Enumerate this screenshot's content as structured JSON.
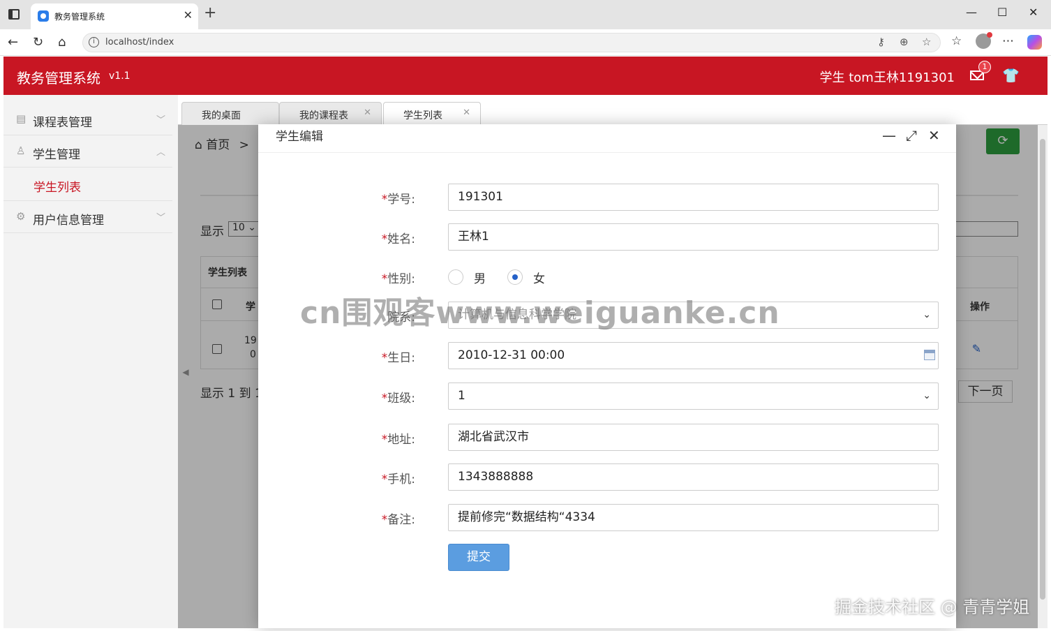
{
  "browser": {
    "tab_title": "教务管理系统",
    "url": "localhost/index"
  },
  "app": {
    "title": "教务管理系统",
    "version": "v1.1",
    "user": "学生  tom王林1191301",
    "mail_badge": "1",
    "brand_color": "#c81623"
  },
  "sidebar": {
    "items": [
      {
        "label": "课程表管理"
      },
      {
        "label": "学生管理"
      },
      {
        "label": "用户信息管理"
      }
    ],
    "sub_items": [
      {
        "label": "学生列表"
      }
    ]
  },
  "content_tabs": [
    {
      "label": "我的桌面"
    },
    {
      "label": "我的课程表"
    },
    {
      "label": "学生列表"
    }
  ],
  "page": {
    "breadcrumb_home": "首页",
    "breadcrumb_sep": ">",
    "show_label": "显示",
    "page_size": "10",
    "table_title": "学生列表",
    "col_partial": "学",
    "col_op": "操作",
    "row_cell_1": "19",
    "row_cell_2": "0",
    "pager_info": "显示 1 到 1",
    "next_label": "下一页"
  },
  "modal": {
    "title": "学生编辑",
    "fields": {
      "student_id_label": "学号:",
      "student_id": "191301",
      "name_label": "姓名:",
      "name": "王林1",
      "gender_label": "性别:",
      "gender_male": "男",
      "gender_female": "女",
      "dept_label": "院系:",
      "dept": "计算机与信息科学学院",
      "birthday_label": "生日:",
      "birthday": "2010-12-31 00:00",
      "class_label": "班级:",
      "class": "1",
      "address_label": "地址:",
      "address": "湖北省武汉市",
      "phone_label": "手机:",
      "phone": "1343888888",
      "remark_label": "备注:",
      "remark": "提前修完“数据结构“4334"
    },
    "required_mark": "*",
    "submit_label": "提交"
  },
  "watermarks": {
    "center": "cn围观客www.weiguanke.cn",
    "corner": "掘金技术社区 @ 青青学姐"
  }
}
